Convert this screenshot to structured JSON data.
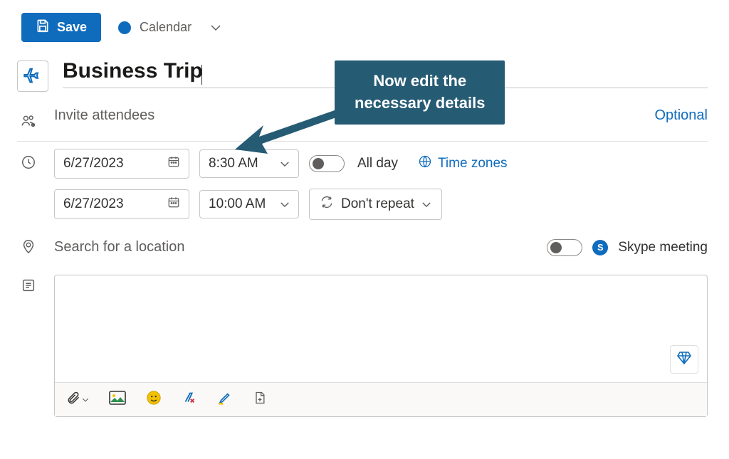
{
  "toolbar": {
    "save_label": "Save",
    "calendar_label": "Calendar"
  },
  "event": {
    "title": "Business Trip",
    "icon_name": "airplane"
  },
  "attendees": {
    "placeholder": "Invite attendees",
    "optional_label": "Optional"
  },
  "datetime": {
    "start_date": "6/27/2023",
    "start_time": "8:30 AM",
    "end_date": "6/27/2023",
    "end_time": "10:00 AM",
    "allday_label": "All day",
    "allday_on": false,
    "timezones_label": "Time zones",
    "repeat_label": "Don't repeat"
  },
  "location": {
    "placeholder": "Search for a location",
    "skype_label": "Skype meeting",
    "skype_on": false
  },
  "annotation": {
    "line1": "Now edit the",
    "line2": "necessary details"
  }
}
